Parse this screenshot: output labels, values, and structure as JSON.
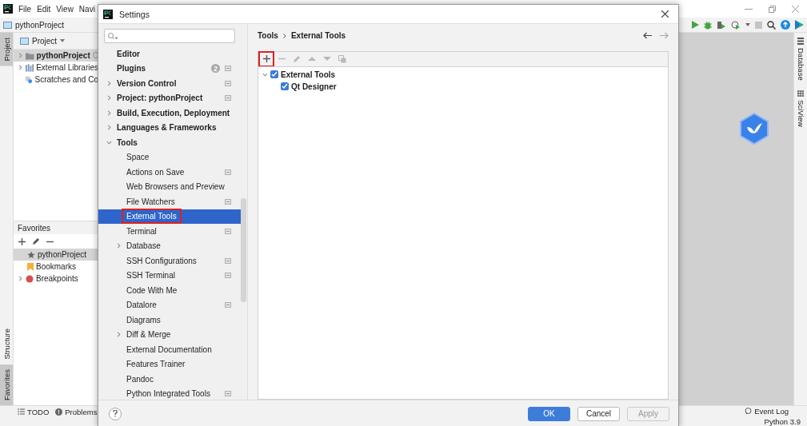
{
  "ide": {
    "menu": [
      "File",
      "Edit",
      "View",
      "Navi"
    ],
    "project_title": "pythonProject",
    "left_strip_top": [
      {
        "label": "Project",
        "selected": true
      }
    ],
    "left_strip_bottom": [
      {
        "label": "Structure",
        "selected": false
      },
      {
        "label": "Favorites",
        "selected": true
      }
    ],
    "right_strip": [
      {
        "label": "Database",
        "kind": "database"
      },
      {
        "label": "SciView",
        "kind": "sciview"
      }
    ],
    "project_panel": {
      "header": "Project",
      "tree": [
        {
          "label": "pythonProject",
          "suffix": "C",
          "kind": "folder",
          "expanded": false,
          "selected": true
        },
        {
          "label": "External Libraries",
          "kind": "libraries",
          "expanded": false,
          "selected": false
        },
        {
          "label": "Scratches and Co",
          "kind": "scratches",
          "selected": false
        }
      ]
    },
    "favorites": {
      "header": "Favorites",
      "items": [
        {
          "label": "pythonProject",
          "kind": "favorite",
          "selected": true
        },
        {
          "label": "Bookmarks",
          "kind": "bookmarks",
          "selected": false
        },
        {
          "label": "Breakpoints",
          "kind": "breakpoints",
          "expanded": false,
          "selected": false
        }
      ]
    },
    "bottom_tabs": [
      {
        "label": "TODO",
        "kind": "todo"
      },
      {
        "label": "Problems",
        "kind": "problems"
      }
    ],
    "status_bar": {
      "event_log": "Event Log",
      "interpreter": "Python 3.9"
    }
  },
  "settings": {
    "title": "Settings",
    "tree": [
      {
        "label": "Editor",
        "selected": false
      },
      {
        "label": "Plugins",
        "count": "2",
        "scope_icon": true,
        "selected": false
      },
      {
        "label": "Version Control",
        "expanded": false,
        "scope_icon": true,
        "selected": false
      },
      {
        "label": "Project: pythonProject",
        "expanded": false,
        "scope_icon": true,
        "selected": false
      },
      {
        "label": "Build, Execution, Deployment",
        "expanded": false,
        "selected": false
      },
      {
        "label": "Languages & Frameworks",
        "expanded": false,
        "selected": false
      },
      {
        "label": "Tools",
        "expanded": true,
        "selected": false,
        "children": [
          {
            "label": "Space",
            "selected": false
          },
          {
            "label": "Actions on Save",
            "scope_icon": true,
            "selected": false
          },
          {
            "label": "Web Browsers and Preview",
            "selected": false
          },
          {
            "label": "File Watchers",
            "scope_icon": true,
            "selected": false
          },
          {
            "label": "External Tools",
            "selected": true,
            "highlighted": true
          },
          {
            "label": "Terminal",
            "scope_icon": true,
            "selected": false
          },
          {
            "label": "Database",
            "expanded": false,
            "selected": false
          },
          {
            "label": "SSH Configurations",
            "scope_icon": true,
            "selected": false
          },
          {
            "label": "SSH Terminal",
            "scope_icon": true,
            "selected": false
          },
          {
            "label": "Code With Me",
            "selected": false
          },
          {
            "label": "Datalore",
            "scope_icon": true,
            "selected": false
          },
          {
            "label": "Diagrams",
            "selected": false
          },
          {
            "label": "Diff & Merge",
            "expanded": false,
            "selected": false
          },
          {
            "label": "External Documentation",
            "selected": false
          },
          {
            "label": "Features Trainer",
            "selected": false
          },
          {
            "label": "Pandoc",
            "selected": false
          },
          {
            "label": "Python Integrated Tools",
            "scope_icon": true,
            "selected": false
          }
        ]
      }
    ],
    "breadcrumb": [
      "Tools",
      "External Tools"
    ],
    "toolbar": [
      {
        "kind": "add",
        "disabled": false,
        "highlighted": true
      },
      {
        "kind": "remove",
        "disabled": true,
        "highlighted": false
      },
      {
        "kind": "edit",
        "disabled": true,
        "highlighted": false
      },
      {
        "kind": "up",
        "disabled": true,
        "highlighted": false
      },
      {
        "kind": "down",
        "disabled": true,
        "highlighted": false
      },
      {
        "kind": "copy",
        "disabled": true,
        "highlighted": false
      }
    ],
    "tools_tree": [
      {
        "label": "External Tools",
        "checked": true,
        "expanded": true,
        "children": [
          {
            "label": "Qt Designer",
            "checked": true
          }
        ]
      }
    ],
    "buttons": [
      {
        "label": "OK",
        "kind": "primary",
        "disabled": false
      },
      {
        "label": "Cancel",
        "kind": "normal",
        "disabled": false
      },
      {
        "label": "Apply",
        "kind": "normal",
        "disabled": true
      }
    ]
  }
}
